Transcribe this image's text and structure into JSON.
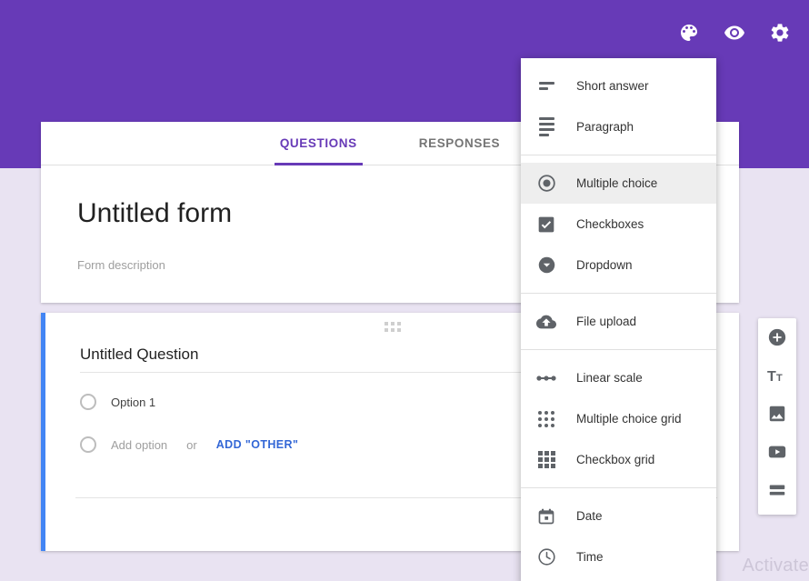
{
  "theme": {
    "header_color": "#673AB7",
    "background_color": "#E9E3F2",
    "accent_blue": "#4285F4",
    "link_blue": "#3367D6"
  },
  "header": {
    "actions": [
      {
        "name": "palette-icon",
        "label": "Change theme"
      },
      {
        "name": "eye-icon",
        "label": "Preview"
      },
      {
        "name": "gear-icon",
        "label": "Settings"
      }
    ]
  },
  "tabs": [
    {
      "label": "QUESTIONS",
      "active": true
    },
    {
      "label": "RESPONSES",
      "active": false
    }
  ],
  "form": {
    "title": "Untitled form",
    "description_placeholder": "Form description"
  },
  "question": {
    "title": "Untitled Question",
    "options": [
      {
        "label": "Option 1"
      }
    ],
    "add_option_label": "Add option",
    "or_label": "or",
    "add_other_label": "ADD \"OTHER\""
  },
  "side_toolbar": [
    {
      "name": "add-question-icon",
      "label": "Add question"
    },
    {
      "name": "title-text-icon",
      "label": "Add title and description"
    },
    {
      "name": "image-icon",
      "label": "Add image"
    },
    {
      "name": "video-icon",
      "label": "Add video"
    },
    {
      "name": "section-icon",
      "label": "Add section"
    }
  ],
  "type_menu": {
    "groups": [
      {
        "items": [
          {
            "label": "Short answer",
            "icon": "short-answer-icon",
            "selected": false
          },
          {
            "label": "Paragraph",
            "icon": "paragraph-icon",
            "selected": false
          }
        ]
      },
      {
        "items": [
          {
            "label": "Multiple choice",
            "icon": "radio-button-icon",
            "selected": true
          },
          {
            "label": "Checkboxes",
            "icon": "checkbox-icon",
            "selected": false
          },
          {
            "label": "Dropdown",
            "icon": "dropdown-icon",
            "selected": false
          }
        ]
      },
      {
        "items": [
          {
            "label": "File upload",
            "icon": "cloud-upload-icon",
            "selected": false
          }
        ]
      },
      {
        "items": [
          {
            "label": "Linear scale",
            "icon": "linear-scale-icon",
            "selected": false
          },
          {
            "label": "Multiple choice grid",
            "icon": "radio-grid-icon",
            "selected": false
          },
          {
            "label": "Checkbox grid",
            "icon": "checkbox-grid-icon",
            "selected": false
          }
        ]
      },
      {
        "items": [
          {
            "label": "Date",
            "icon": "calendar-icon",
            "selected": false
          },
          {
            "label": "Time",
            "icon": "clock-icon",
            "selected": false
          }
        ]
      }
    ]
  },
  "watermark": {
    "text": "Activate"
  }
}
